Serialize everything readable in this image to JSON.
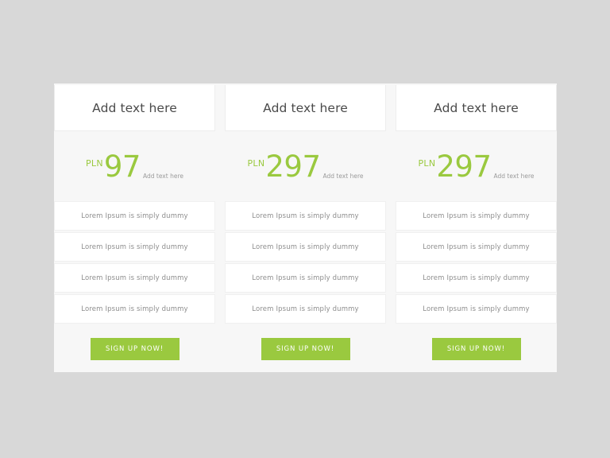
{
  "theme": {
    "page_background": "#d8d8d8",
    "panel_background": "#f7f7f7",
    "card_background": "#ffffff",
    "accent_green": "#9ac93f",
    "heading_color": "#4a4a4a",
    "feature_text_color": "#8d8d8d"
  },
  "plans": [
    {
      "title": "Add text here",
      "currency": "PLN",
      "amount": "97",
      "price_suffix": "Add text here",
      "features": [
        "Lorem Ipsum is simply dummy",
        "Lorem Ipsum is simply dummy",
        "Lorem Ipsum is simply dummy",
        "Lorem Ipsum is simply dummy"
      ],
      "cta_label": "SIGN UP NOW!"
    },
    {
      "title": "Add text here",
      "currency": "PLN",
      "amount": "297",
      "price_suffix": "Add text here",
      "features": [
        "Lorem Ipsum is simply dummy",
        "Lorem Ipsum is simply dummy",
        "Lorem Ipsum is simply dummy",
        "Lorem Ipsum is simply dummy"
      ],
      "cta_label": "SIGN UP NOW!"
    },
    {
      "title": "Add text here",
      "currency": "PLN",
      "amount": "297",
      "price_suffix": "Add text here",
      "features": [
        "Lorem Ipsum is simply dummy",
        "Lorem Ipsum is simply dummy",
        "Lorem Ipsum is simply dummy",
        "Lorem Ipsum is simply dummy"
      ],
      "cta_label": "SIGN UP NOW!"
    }
  ]
}
